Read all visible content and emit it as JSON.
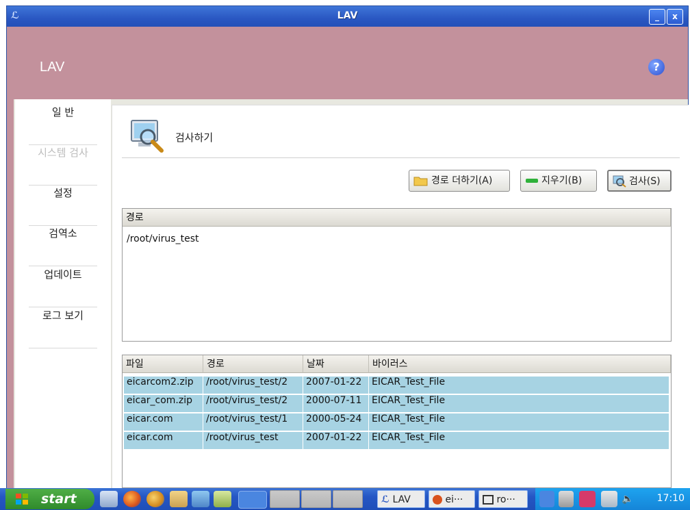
{
  "window": {
    "title": "LAV",
    "app_icon": "lav-logo-icon",
    "minimize": "_",
    "close": "x"
  },
  "header": {
    "brand": "LAV",
    "help": "?"
  },
  "sidebar": {
    "items": [
      {
        "label": "일 반",
        "enabled": true
      },
      {
        "label": "시스템 검사",
        "enabled": false
      },
      {
        "label": "설정",
        "enabled": true
      },
      {
        "label": "검역소",
        "enabled": true
      },
      {
        "label": "업데이트",
        "enabled": true
      },
      {
        "label": "로그 보기",
        "enabled": true
      }
    ]
  },
  "main": {
    "title": "검사하기",
    "buttons": {
      "add_path": "경로 더하기(A)",
      "clear": "지우기(B)",
      "scan": "검사(S)"
    },
    "path_list": {
      "header": "경로",
      "rows": [
        "/root/virus_test"
      ]
    },
    "results": {
      "headers": [
        "파일",
        "경로",
        "날짜",
        "바이러스"
      ],
      "rows": [
        [
          "eicarcom2.zip",
          "/root/virus_test/2",
          "2007-01-22",
          "EICAR_Test_File"
        ],
        [
          "eicar_com.zip",
          "/root/virus_test/2",
          "2000-07-11",
          "EICAR_Test_File"
        ],
        [
          "eicar.com",
          "/root/virus_test/1",
          "2000-05-24",
          "EICAR_Test_File"
        ],
        [
          "eicar.com",
          "/root/virus_test",
          "2007-01-22",
          "EICAR_Test_File"
        ]
      ]
    }
  },
  "taskbar": {
    "start": "start",
    "tasks": [
      "LAV",
      "ei···",
      "ro···"
    ],
    "clock": "17:10"
  },
  "colors": {
    "header": "#c3919c",
    "selection": "#a7d3e3",
    "titlebar": "#2a57c2",
    "taskbar": "#2556c4"
  }
}
